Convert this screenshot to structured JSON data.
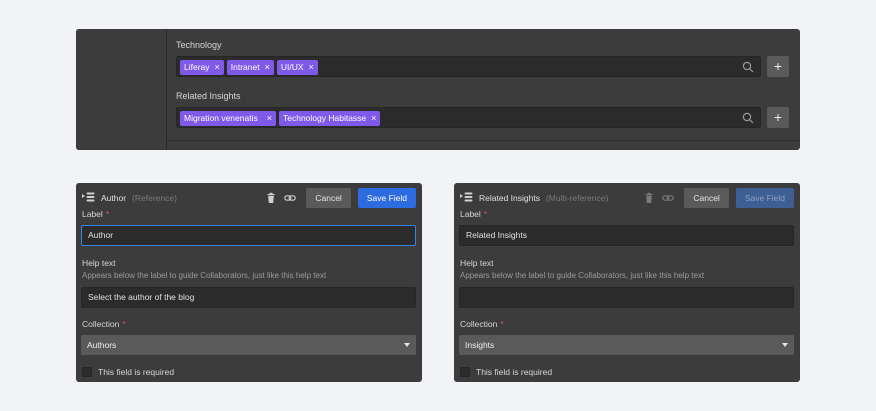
{
  "top_panel": {
    "technology": {
      "label": "Technology",
      "tags": [
        "Liferay",
        "Intranet",
        "UI/UX"
      ]
    },
    "related_insights": {
      "label": "Related Insights",
      "tags": [
        "Migration venenatis",
        "Technology Habitasse"
      ]
    },
    "tag_remove_glyph": "×",
    "add_glyph": "+"
  },
  "author_card": {
    "title": "Author",
    "type": "(Reference)",
    "cancel_label": "Cancel",
    "save_label": "Save Field",
    "label_label": "Label",
    "label_value": "Author",
    "help_label": "Help text",
    "help_hint": "Appears below the label to guide Collaborators, just like this help text",
    "help_value": "Select the author of the blog",
    "collection_label": "Collection",
    "collection_value": "Authors",
    "required_label": "This field is required"
  },
  "insights_card": {
    "title": "Related Insights",
    "type": "(Multi-reference)",
    "cancel_label": "Cancel",
    "save_label": "Save Field",
    "label_label": "Label",
    "label_value": "Related Insights",
    "help_label": "Help text",
    "help_hint": "Appears below the label to guide Collaborators, just like this help text",
    "help_value": "",
    "collection_label": "Collection",
    "collection_value": "Insights",
    "required_label": "This field is required"
  },
  "required_mark": "*",
  "colors": {
    "tag": "#7f5ae8",
    "save_button": "#2d6ce0",
    "focus_border": "#3a82e6",
    "panel": "#3c3c3c"
  }
}
